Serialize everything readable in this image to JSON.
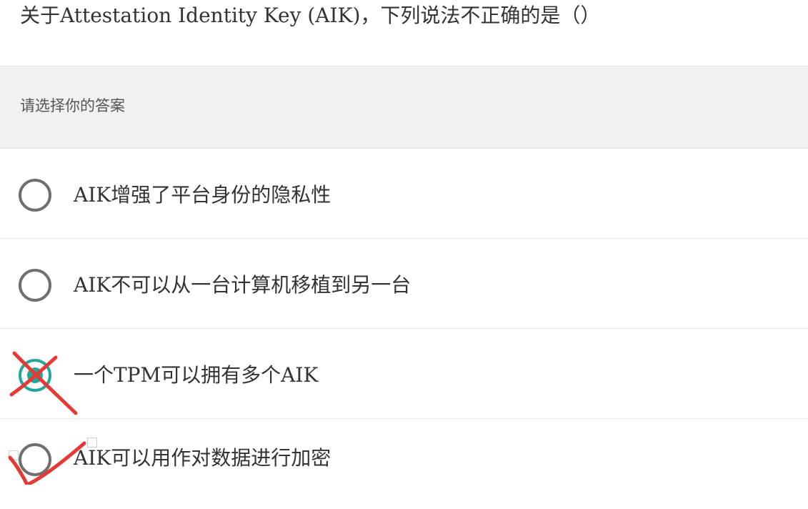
{
  "question": {
    "text": "关于Attestation Identity Key (AIK)，下列说法不正确的是（）"
  },
  "prompt": {
    "text": "请选择你的答案"
  },
  "options": [
    {
      "label": "AIK增强了平台身份的隐私性",
      "selected": false
    },
    {
      "label": "AIK不可以从一台计算机移植到另一台",
      "selected": false
    },
    {
      "label": "一个TPM可以拥有多个AIK",
      "selected": true
    },
    {
      "label": "AIK可以用作对数据进行加密",
      "selected": false
    }
  ],
  "colors": {
    "accent": "#26a69a",
    "radio_border": "#6f6f6f",
    "annotation_red": "#e53935",
    "prompt_bg": "#f1f1f1"
  },
  "annotations": {
    "wrong_mark_icon": "red-x-mark-icon",
    "check_mark_icon": "red-check-mark-icon"
  }
}
